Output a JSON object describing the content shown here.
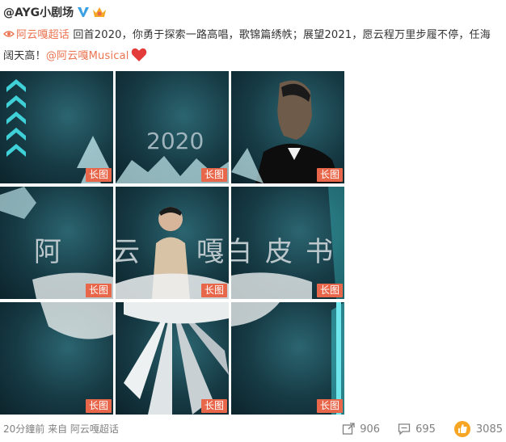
{
  "post": {
    "author": "@AYG小剧场",
    "topic": "阿云嘎超话",
    "text": " 回首2020，你勇于探索一路高唱，歌锦篇绣帙；展望2021，愿云程万里步履不停，任海阔天高！",
    "mention": "@阿云嘎Musical"
  },
  "images": [
    {
      "label": "长图"
    },
    {
      "label": "长图"
    },
    {
      "label": "长图"
    },
    {
      "label": "长图"
    },
    {
      "label": "长图"
    },
    {
      "label": "长图"
    },
    {
      "label": "长图"
    },
    {
      "label": "长图"
    },
    {
      "label": "长图"
    }
  ],
  "art": {
    "year": "2020",
    "title_chars": [
      "阿",
      "云",
      "嘎",
      "白",
      "皮",
      "书"
    ]
  },
  "footer": {
    "time": "20分鐘前",
    "from_prefix": " 来自 ",
    "source": "阿云嘎超话",
    "repost_count": "906",
    "comment_count": "695",
    "like_count": "3085"
  },
  "colors": {
    "accent": "#eb7350",
    "badge": "#e8664a",
    "cyan": "#3fd0d8",
    "verified": "#3ba0e3"
  },
  "icons": [
    "verified-icon",
    "crown-icon",
    "topic-icon",
    "heart-icon",
    "repost-icon",
    "comment-icon",
    "like-icon"
  ]
}
